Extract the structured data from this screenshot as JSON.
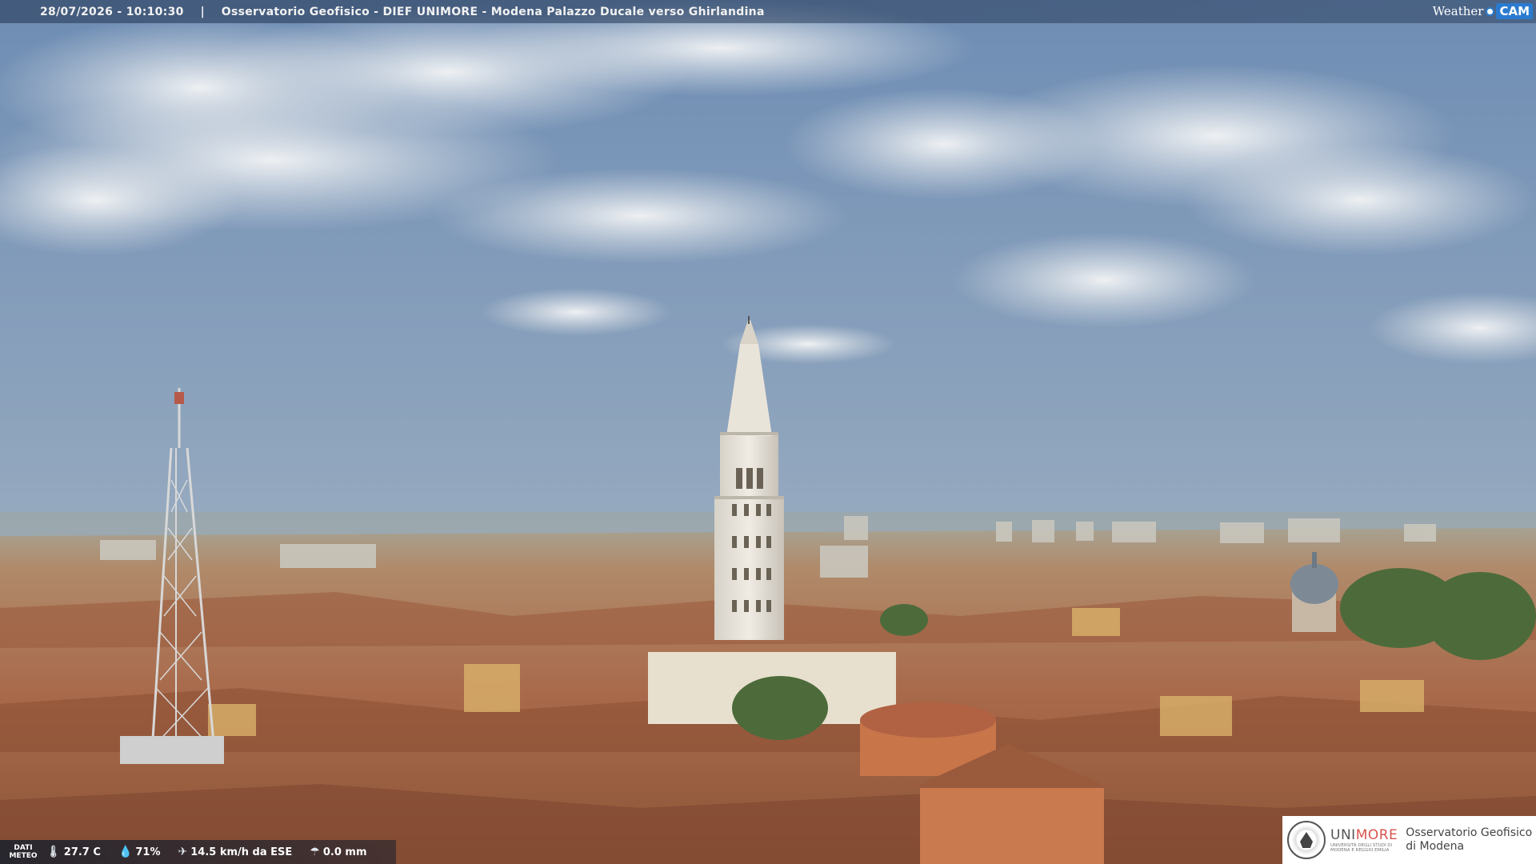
{
  "overlay": {
    "timestamp": "28/07/2026 - 10:10:30",
    "separator": "|",
    "title": "Osservatorio Geofisico - DIEF UNIMORE - Modena Palazzo Ducale verso Ghirlandina"
  },
  "brand": {
    "weather_text": "Weather",
    "cam_text": "CAM"
  },
  "meteo": {
    "label_line1": "DATI",
    "label_line2": "METEO",
    "temperature": "27.7 C",
    "humidity": "71%",
    "wind": "14.5 km/h da ESE",
    "rain": "0.0 mm",
    "icons": {
      "temperature": "thermometer-icon",
      "humidity": "droplet-icon",
      "wind": "wind-icon",
      "rain": "rain-icon"
    }
  },
  "logo": {
    "name_prefix": "UNI",
    "name_suffix": "MORE",
    "subtitle_line1": "UNIVERSITÀ DEGLI STUDI DI",
    "subtitle_line2": "MODENA E REGGIO EMILIA",
    "observatory_line1": "Osservatorio Geofisico",
    "observatory_line2": "di Modena"
  },
  "colors": {
    "sky_top": "#6f8eb5",
    "sky_horizon": "#b7c3cc",
    "roof": "#a86a48",
    "tower": "#e6e1d8",
    "accent_red": "#d9534f",
    "accent_blue": "#2a7bd0"
  }
}
